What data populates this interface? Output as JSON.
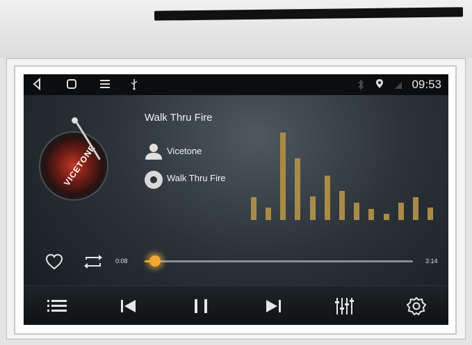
{
  "status_bar": {
    "icons": [
      "back-icon",
      "home-icon",
      "menu-icon",
      "usb-icon",
      "bluetooth-icon",
      "location-icon",
      "signal-icon"
    ],
    "time": "09:53"
  },
  "player": {
    "track_title": "Walk Thru Fire",
    "artist": "Vicetone",
    "album": "Walk Thru Fire",
    "album_art_text": "VICETONE",
    "time_current": "0:08",
    "time_total": "3:14",
    "progress": 0.04,
    "equalizer_levels": [
      0.26,
      0.14,
      1.0,
      0.71,
      0.27,
      0.51,
      0.33,
      0.2,
      0.13,
      0.07,
      0.2,
      0.26,
      0.14
    ],
    "accent_color": "#e8a230",
    "eq_color": "#a88b48"
  },
  "controls": {
    "top": [
      "heart-icon",
      "repeat-icon"
    ],
    "bottom": [
      "playlist-icon",
      "previous-icon",
      "pause-icon",
      "next-icon",
      "equalizer-icon",
      "settings-icon"
    ]
  }
}
